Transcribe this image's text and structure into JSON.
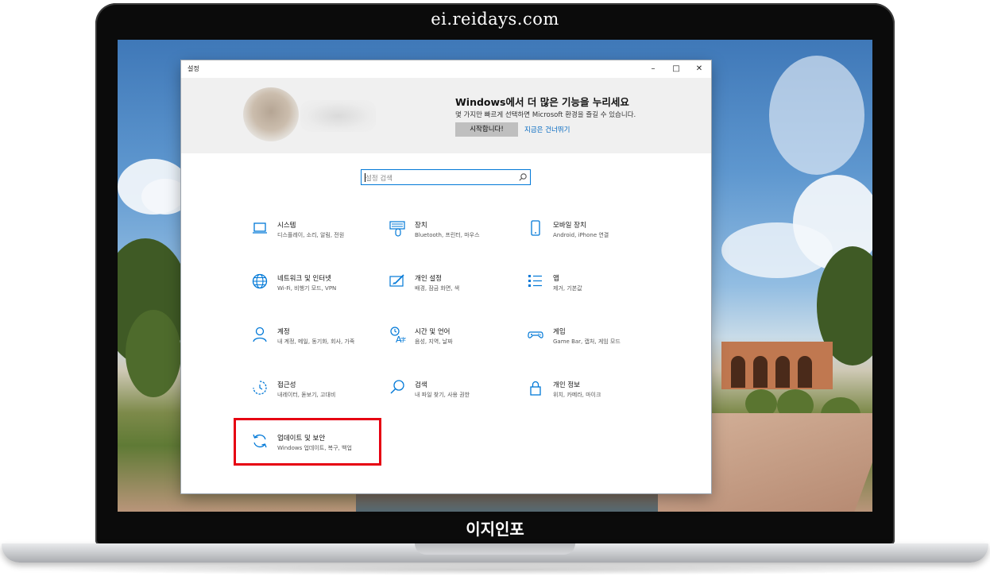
{
  "frame": {
    "top_caption": "ei.reidays.com",
    "bottom_caption": "이지인포"
  },
  "window": {
    "title": "설정",
    "controls": {
      "minimize": "–",
      "maximize": "□",
      "close": "✕"
    }
  },
  "banner": {
    "title": "Windows에서 더 많은 기능을 누리세요",
    "description": "몇 가지만 빠르게 선택하면 Microsoft 환경을 즐길 수 있습니다.",
    "start_button": "시작합니다!",
    "skip_link": "지금은 건너뛰기"
  },
  "search": {
    "placeholder": "설정 검색",
    "icon": "search-icon"
  },
  "categories": [
    {
      "name": "시스템",
      "desc": "디스플레이, 소리, 알림, 전원",
      "icon": "laptop-icon"
    },
    {
      "name": "장치",
      "desc": "Bluetooth, 프린터, 마우스",
      "icon": "devices-icon"
    },
    {
      "name": "모바일 장치",
      "desc": "Android, iPhone 연결",
      "icon": "phone-icon"
    },
    {
      "name": "네트워크 및 인터넷",
      "desc": "Wi-Fi, 비행기 모드, VPN",
      "icon": "globe-icon"
    },
    {
      "name": "개인 설정",
      "desc": "배경, 잠금 화면, 색",
      "icon": "personalization-icon"
    },
    {
      "name": "앱",
      "desc": "제거, 기본값",
      "icon": "apps-list-icon"
    },
    {
      "name": "계정",
      "desc": "내 계정, 메일, 동기화, 회사, 가족",
      "icon": "person-icon"
    },
    {
      "name": "시간 및 언어",
      "desc": "음성, 지역, 날짜",
      "icon": "time-language-icon"
    },
    {
      "name": "게임",
      "desc": "Game Bar, 캡처, 게임 모드",
      "icon": "gamepad-icon"
    },
    {
      "name": "접근성",
      "desc": "내레이터, 돋보기, 고대비",
      "icon": "accessibility-icon"
    },
    {
      "name": "검색",
      "desc": "내 파일 찾기, 사용 권한",
      "icon": "search-icon"
    },
    {
      "name": "개인 정보",
      "desc": "위치, 카메라, 마이크",
      "icon": "lock-icon"
    },
    {
      "name": "업데이트 및 보안",
      "desc": "Windows 업데이트, 복구, 백업",
      "icon": "update-icon"
    }
  ],
  "colors": {
    "accent": "#0078d7",
    "highlight": "#e60012",
    "banner_bg": "#f0f0f0"
  }
}
